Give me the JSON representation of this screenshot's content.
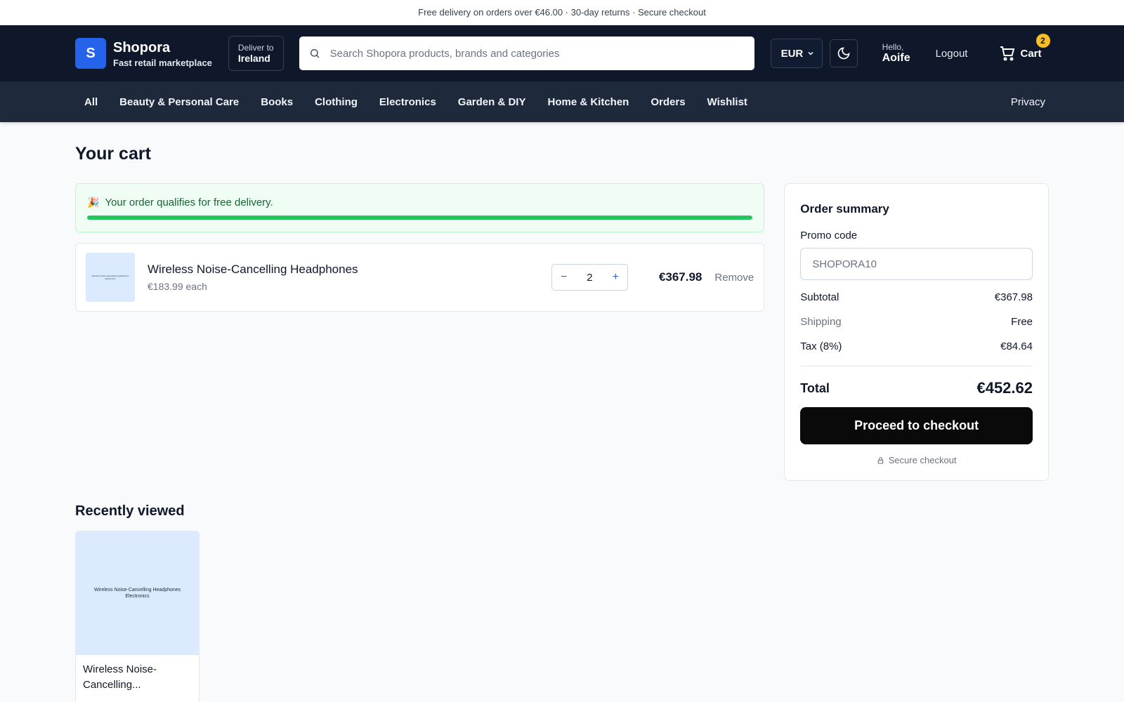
{
  "promo_bar": {
    "text": "Free delivery on orders over €46.00 · 30-day returns · Secure checkout"
  },
  "header": {
    "logo_letter": "S",
    "brand_name": "Shopora",
    "brand_tagline": "Fast retail marketplace",
    "deliver_label": "Deliver to",
    "deliver_value": "Ireland",
    "search_placeholder": "Search Shopora products, brands and categories",
    "currency": "EUR",
    "user_greeting": "Hello,",
    "user_name": "Aoife",
    "logout_label": "Logout",
    "cart_label": "Cart",
    "cart_count": "2"
  },
  "nav": {
    "items": [
      {
        "label": "All"
      },
      {
        "label": "Beauty & Personal Care"
      },
      {
        "label": "Books"
      },
      {
        "label": "Clothing"
      },
      {
        "label": "Electronics"
      },
      {
        "label": "Garden & DIY"
      },
      {
        "label": "Home & Kitchen"
      },
      {
        "label": "Orders"
      },
      {
        "label": "Wishlist"
      }
    ],
    "privacy": "Privacy"
  },
  "page": {
    "title": "Your cart"
  },
  "free_delivery": {
    "message": "Your order qualifies for free delivery.",
    "progress_percent": 100,
    "color": "#22c55e"
  },
  "cart_items": [
    {
      "thumb_text": "Wireless Noise-Cancelling Headphones Electronics",
      "name": "Wireless Noise-Cancelling Headphones",
      "unit_price": "€183.99 each",
      "quantity": "2",
      "line_total": "€367.98",
      "remove_label": "Remove"
    }
  ],
  "summary": {
    "title": "Order summary",
    "promo_label": "Promo code",
    "promo_placeholder": "SHOPORA10",
    "subtotal_label": "Subtotal",
    "subtotal_value": "€367.98",
    "shipping_label": "Shipping",
    "shipping_value": "Free",
    "tax_label": "Tax (8%)",
    "tax_value": "€84.64",
    "total_label": "Total",
    "total_value": "€452.62",
    "checkout_label": "Proceed to checkout",
    "secure_label": "Secure checkout"
  },
  "recently_viewed": {
    "title": "Recently viewed",
    "items": [
      {
        "image_title": "Wireless Noise-Cancelling Headphones",
        "image_category": "Electronics",
        "name": "Wireless Noise-Cancelling..."
      }
    ]
  },
  "colors": {
    "header_bg": "#0f172a",
    "nav_bg": "#1e293b",
    "accent": "#2563eb",
    "badge": "#fbbf24",
    "success": "#22c55e"
  }
}
